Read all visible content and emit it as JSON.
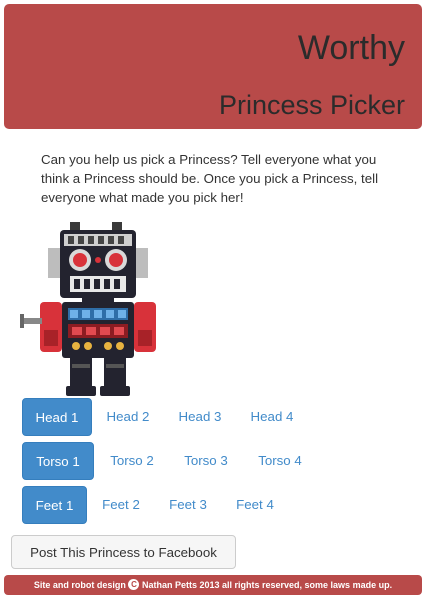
{
  "header": {
    "title": "Worthy",
    "subtitle": "Princess Picker",
    "color": "#b84a49"
  },
  "intro": "Can you help us pick a Princess? Tell everyone what you think a Princess should be. Once you pick a Princess, tell everyone what made you pick her!",
  "robot": {
    "icon": "robot-illustration"
  },
  "options": {
    "head": {
      "items": [
        "Head 1",
        "Head 2",
        "Head 3",
        "Head 4"
      ],
      "selected": 0
    },
    "torso": {
      "items": [
        "Torso 1",
        "Torso 2",
        "Torso 3",
        "Torso 4"
      ],
      "selected": 0
    },
    "feet": {
      "items": [
        "Feet 1",
        "Feet 2",
        "Feet 3",
        "Feet 4"
      ],
      "selected": 0
    }
  },
  "accent_color": "#428bca",
  "facebook_button": "Post This Princess to Facebook",
  "footer": {
    "before": "Site and robot design",
    "copyright_symbol": "C",
    "after": "Nathan Petts 2013 all rights reserved, some laws made up."
  }
}
